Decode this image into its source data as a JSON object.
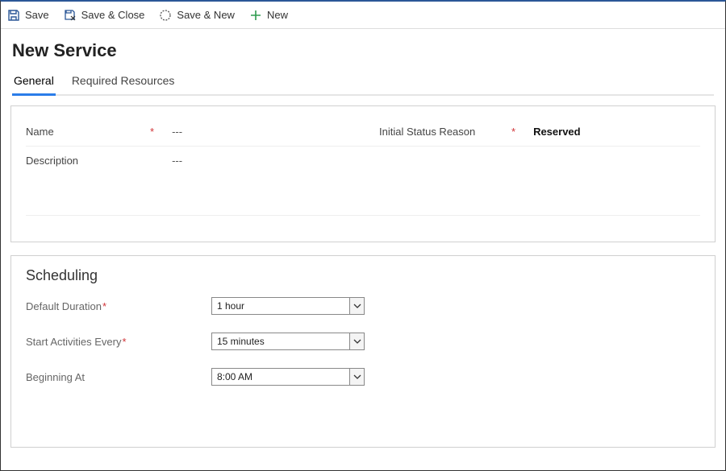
{
  "toolbar": {
    "save": "Save",
    "save_close": "Save & Close",
    "save_new": "Save & New",
    "new": "New"
  },
  "header": {
    "title": "New Service",
    "tabs": {
      "general": "General",
      "required_resources": "Required Resources"
    }
  },
  "general": {
    "name_label": "Name",
    "name_value": "---",
    "description_label": "Description",
    "description_value": "---",
    "initial_status_label": "Initial Status Reason",
    "initial_status_value": "Reserved"
  },
  "scheduling": {
    "section_title": "Scheduling",
    "default_duration_label": "Default Duration",
    "default_duration_value": "1 hour",
    "start_every_label": "Start Activities Every",
    "start_every_value": "15 minutes",
    "beginning_label": "Beginning At",
    "beginning_value": "8:00 AM"
  },
  "required_star": "*"
}
